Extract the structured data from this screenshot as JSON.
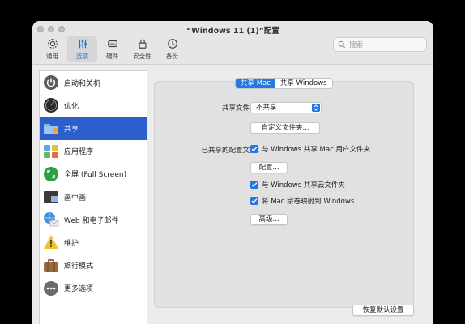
{
  "window": {
    "title": "“Windows 11 (1)”配置"
  },
  "toolbar": {
    "tabs": [
      {
        "label": "通用",
        "icon": "gear-icon"
      },
      {
        "label": "选项",
        "icon": "sliders-icon"
      },
      {
        "label": "硬件",
        "icon": "chip-icon"
      },
      {
        "label": "安全性",
        "icon": "lock-icon"
      },
      {
        "label": "备份",
        "icon": "clock-icon"
      }
    ],
    "active_tab": "选项",
    "search_placeholder": "搜索"
  },
  "sidebar": {
    "items": [
      {
        "label": "启动和关机",
        "icon": "power-icon"
      },
      {
        "label": "优化",
        "icon": "speedometer-icon"
      },
      {
        "label": "共享",
        "icon": "shared-folder-icon"
      },
      {
        "label": "应用程序",
        "icon": "applications-icon"
      },
      {
        "label": "全屏 (Full Screen)",
        "icon": "fullscreen-icon"
      },
      {
        "label": "画中画",
        "icon": "picture-in-picture-icon"
      },
      {
        "label": "Web 和电子邮件",
        "icon": "globe-mail-icon"
      },
      {
        "label": "维护",
        "icon": "warning-icon"
      },
      {
        "label": "旅行模式",
        "icon": "suitcase-icon"
      },
      {
        "label": "更多选项",
        "icon": "more-icon"
      }
    ],
    "active_item": "共享"
  },
  "main": {
    "segments": [
      "共享 Mac",
      "共享 Windows"
    ],
    "active_segment": "共享 Mac",
    "shared_folders_label": "共享文件夹：",
    "shared_folders_value": "不共享",
    "custom_folders_button": "自定义文件夹...",
    "shared_profile_label": "已共享的配置文件：",
    "share_mac_user_folders": "与 Windows 共享 Mac 用户文件夹",
    "configure_button": "配置...",
    "share_cloud_folders": "与 Windows 共享云文件夹",
    "map_mac_volumes": "将 Mac 宗卷映射到 Windows",
    "advanced_button": "高级...",
    "restore_defaults_button": "恢复默认设置"
  },
  "colors": {
    "accent": "#2477e5",
    "sidebar_selection": "#2c5fcc"
  }
}
